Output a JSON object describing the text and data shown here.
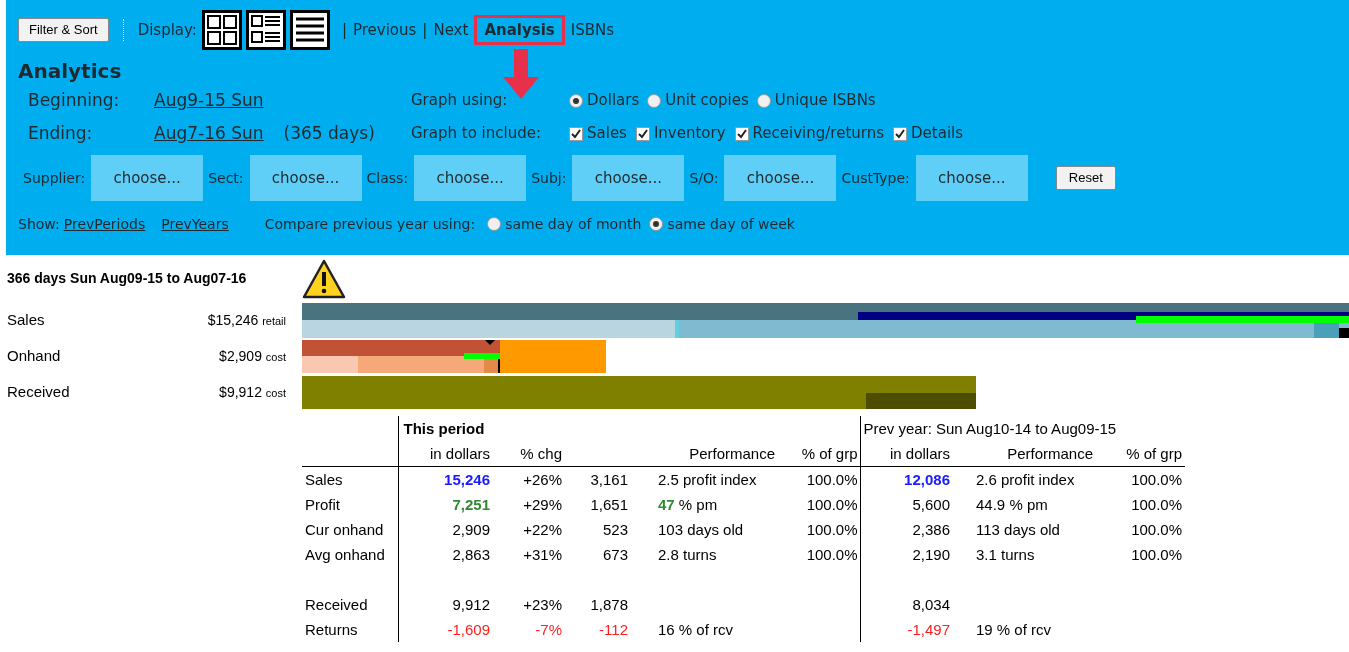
{
  "toolbar": {
    "filter_button": "Filter & Sort",
    "display_label": "Display:",
    "display_modes": [
      {
        "kind": "grid"
      },
      {
        "kind": "cards"
      },
      {
        "kind": "list"
      }
    ],
    "nav": [
      {
        "kind": "separator",
        "text": "|"
      },
      {
        "kind": "link",
        "text": "Previous",
        "highlighted": false
      },
      {
        "kind": "separator",
        "text": "|"
      },
      {
        "kind": "link",
        "text": "Next",
        "highlighted": false
      },
      {
        "kind": "link",
        "text": "Analysis",
        "highlighted": true
      },
      {
        "kind": "link",
        "text": "ISBNs",
        "highlighted": false
      }
    ]
  },
  "heading": "Analytics",
  "range": [
    {
      "label": "Beginning:",
      "date": "Aug9-15 Sun"
    },
    {
      "label": "Ending:",
      "date": "Aug7-16 Sun",
      "note": "(365 days)"
    }
  ],
  "graph_using": {
    "label": "Graph using:",
    "options": [
      {
        "label": "Dollars",
        "selected": true
      },
      {
        "label": "Unit copies",
        "selected": false
      },
      {
        "label": "Unique ISBNs",
        "selected": false
      }
    ]
  },
  "graph_include": {
    "label": "Graph to include:",
    "options": [
      {
        "label": "Sales",
        "checked": true
      },
      {
        "label": "Inventory",
        "checked": true
      },
      {
        "label": "Receiving/returns",
        "checked": true
      },
      {
        "label": "Details",
        "checked": true
      }
    ]
  },
  "filters": [
    {
      "label": "Supplier:",
      "value": "choose..."
    },
    {
      "label": "Sect:",
      "value": "choose..."
    },
    {
      "label": "Class:",
      "value": "choose..."
    },
    {
      "label": "Subj:",
      "value": "choose..."
    },
    {
      "label": "S/O:",
      "value": "choose..."
    },
    {
      "label": "CustType:",
      "value": "choose..."
    }
  ],
  "reset_button": "Reset",
  "show": {
    "label": "Show:",
    "links": [
      "PrevPeriods",
      "PrevYears"
    ]
  },
  "compare": {
    "label": "Compare previous year using:",
    "options": [
      {
        "label": "same day of month",
        "selected": false
      },
      {
        "label": "same day of week",
        "selected": true
      }
    ]
  },
  "summary": {
    "title": "366 days Sun Aug09-15 to Aug07-16",
    "warning": true,
    "rows": [
      {
        "kind": "sales",
        "label": "Sales",
        "amount": "$15,246",
        "basis": "retail"
      },
      {
        "kind": "onhand",
        "label": "Onhand",
        "amount": "$2,909",
        "basis": "cost"
      },
      {
        "kind": "received",
        "label": "Received",
        "amount": "$9,912",
        "basis": "cost"
      }
    ]
  },
  "table": {
    "current_title": "This period",
    "previous_title": "Prev year: Sun Aug10-14 to Aug09-15",
    "columns": {
      "cur_dollars": "in dollars",
      "cur_chg": "% chg",
      "cur_perf": "Performance",
      "cur_grp": "% of grp",
      "prev_dollars": "in dollars",
      "prev_perf": "Performance",
      "prev_grp": "% of grp"
    },
    "rows": [
      {
        "label": "Sales",
        "section_start": false,
        "dollars": {
          "text": "15,246",
          "color": "#1a1aff",
          "bold": true
        },
        "chg": {
          "text": "+26%"
        },
        "units": {
          "text": "3,161"
        },
        "perf": {
          "value": "2.5",
          "unit": "profit index"
        },
        "grp": "100.0%",
        "prev_dollars": {
          "text": "12,086",
          "color": "#1a1aff",
          "bold": true
        },
        "prev_perf": {
          "value": "2.6",
          "unit": "profit index"
        },
        "prev_grp": "100.0%"
      },
      {
        "label": "Profit",
        "section_start": false,
        "dollars": {
          "text": "7,251",
          "color": "#2e8b2e",
          "bold": true
        },
        "chg": {
          "text": "+29%"
        },
        "units": {
          "text": "1,651"
        },
        "perf": {
          "value": "47",
          "unit": "% pm",
          "color": "#2e8b2e",
          "bold": true
        },
        "grp": "100.0%",
        "prev_dollars": {
          "text": "5,600"
        },
        "prev_perf": {
          "value": "44.9",
          "unit": "% pm"
        },
        "prev_grp": "100.0%"
      },
      {
        "label": "Cur onhand",
        "section_start": false,
        "dollars": {
          "text": "2,909"
        },
        "chg": {
          "text": "+22%"
        },
        "units": {
          "text": "523"
        },
        "perf": {
          "value": "103",
          "unit": "days old"
        },
        "grp": "100.0%",
        "prev_dollars": {
          "text": "2,386"
        },
        "prev_perf": {
          "value": "113",
          "unit": "days old"
        },
        "prev_grp": "100.0%"
      },
      {
        "label": "Avg onhand",
        "section_start": false,
        "dollars": {
          "text": "2,863"
        },
        "chg": {
          "text": "+31%"
        },
        "units": {
          "text": "673"
        },
        "perf": {
          "value": "2.8",
          "unit": "turns"
        },
        "grp": "100.0%",
        "prev_dollars": {
          "text": "2,190"
        },
        "prev_perf": {
          "value": "3.1",
          "unit": "turns"
        },
        "prev_grp": "100.0%"
      },
      {
        "label": "Received",
        "section_start": true,
        "dollars": {
          "text": "9,912"
        },
        "chg": {
          "text": "+23%"
        },
        "units": {
          "text": "1,878"
        },
        "prev_dollars": {
          "text": "8,034"
        }
      },
      {
        "label": "Returns",
        "section_start": false,
        "dollars": {
          "text": "-1,609",
          "color": "#ff2020"
        },
        "chg": {
          "text": "-7%",
          "color": "#ff2020"
        },
        "units": {
          "text": "-112",
          "color": "#ff2020"
        },
        "perf": {
          "value": "16",
          "unit": "% of rcv"
        },
        "prev_dollars": {
          "text": "-1,497",
          "color": "#ff2020"
        },
        "prev_perf": {
          "value": "19",
          "unit": "% of rcv"
        }
      }
    ]
  }
}
